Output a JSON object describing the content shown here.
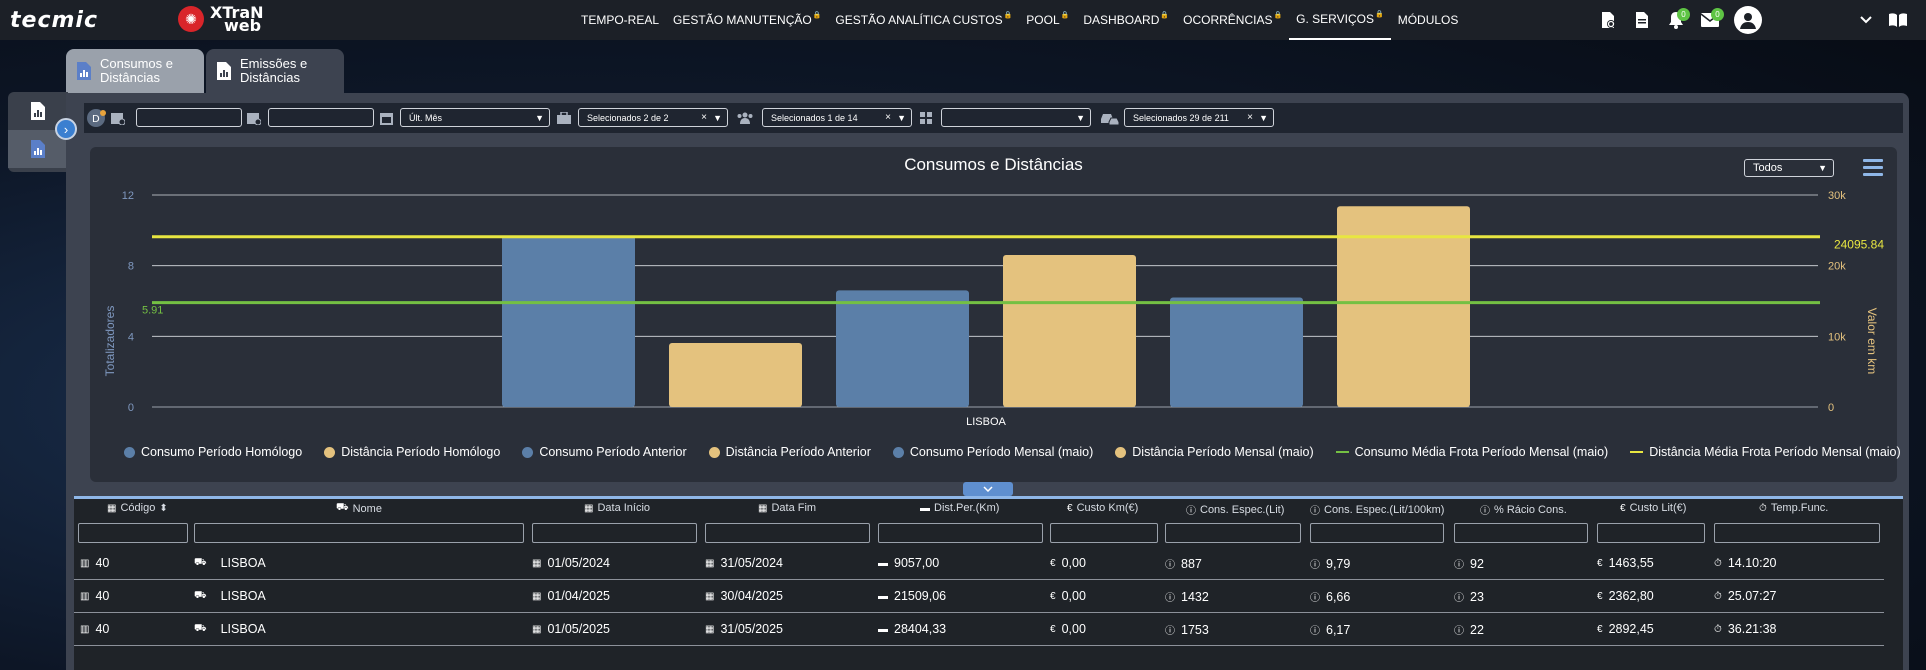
{
  "nav": {
    "logo_left": "tecmic",
    "logo_right_top": "XTraN",
    "logo_right_bottom": "web",
    "menu": [
      {
        "label": "TEMPO-REAL",
        "locked": false
      },
      {
        "label": "GESTÃO MANUTENÇÃO",
        "locked": true
      },
      {
        "label": "GESTÃO ANALÍTICA CUSTOS",
        "locked": true
      },
      {
        "label": "POOL",
        "locked": true
      },
      {
        "label": "DASHBOARD",
        "locked": true
      },
      {
        "label": "OCORRÊNCIAS",
        "locked": true
      },
      {
        "label": "G. SERVIÇOS",
        "locked": true,
        "active": true
      },
      {
        "label": "MÓDULOS",
        "locked": false
      }
    ],
    "notifications_count": "0",
    "messages_count": "0"
  },
  "tabs": [
    {
      "label_line1": "Consumos e",
      "label_line2": "Distâncias",
      "active": true
    },
    {
      "label_line1": "Emissões e",
      "label_line2": "Distâncias",
      "active": false
    }
  ],
  "filters": {
    "date_start": "",
    "date_end": "",
    "period": "Últ. Mês",
    "companies": "Selecionados 2 de 2",
    "groups": "Selecionados 1 de 14",
    "layout": "",
    "vehicles": "Selecionados 29 de 211"
  },
  "chart_selector": "Todos",
  "chart_data": {
    "type": "bar",
    "title": "Consumos e Distâncias",
    "categories": [
      "LISBOA"
    ],
    "ylabel_left": "Totalizadores",
    "ylabel_right": "Valor em km",
    "ylim_left": [
      0,
      12
    ],
    "yticks_left": [
      "0",
      "4",
      "8",
      "12"
    ],
    "ylim_right": [
      0,
      30000
    ],
    "yticks_right": [
      "0",
      "10k",
      "20k",
      "30k"
    ],
    "series": [
      {
        "name": "Consumo Período Homólogo",
        "axis": "left",
        "value": 9.7,
        "color": "#5b7fa8"
      },
      {
        "name": "Distância Período Homólogo",
        "axis": "right",
        "value": 9057,
        "color": "#e4c27e"
      },
      {
        "name": "Consumo Período Anterior",
        "axis": "left",
        "value": 6.6,
        "color": "#5b7fa8"
      },
      {
        "name": "Distância Período Anterior",
        "axis": "right",
        "value": 21509,
        "color": "#e4c27e"
      },
      {
        "name": "Consumo Período Mensal (maio)",
        "axis": "left",
        "value": 6.2,
        "color": "#5b7fa8"
      },
      {
        "name": "Distância Período Mensal (maio)",
        "axis": "right",
        "value": 28404,
        "color": "#e4c27e"
      }
    ],
    "lines": [
      {
        "name": "Consumo Média Frota Período Mensal (maio)",
        "axis": "left",
        "value": 5.91,
        "label": "5.91",
        "color": "#74c043"
      },
      {
        "name": "Distância Média Frota Período Mensal (maio)",
        "axis": "right",
        "value": 24095.84,
        "label": "24095.84",
        "color": "#e8e641"
      }
    ],
    "grid": true,
    "legend": "bottom"
  },
  "table": {
    "headers": [
      "Código",
      "Nome",
      "Data Início",
      "Data Fim",
      "Dist.Per.(Km)",
      "Custo Km(€)",
      "Cons. Espec.(Lit)",
      "Cons. Espec.(Lit/100km)",
      "% Rácio Cons.",
      "Custo Lit(€)",
      "Temp.Func."
    ],
    "rows": [
      [
        "40",
        "LISBOA",
        "01/05/2024",
        "31/05/2024",
        "9057,00",
        "0,00",
        "887",
        "9,79",
        "92",
        "1463,55",
        "14.10:20"
      ],
      [
        "40",
        "LISBOA",
        "01/04/2025",
        "30/04/2025",
        "21509,06",
        "0,00",
        "1432",
        "6,66",
        "23",
        "2362,80",
        "25.07:27"
      ],
      [
        "40",
        "LISBOA",
        "01/05/2025",
        "31/05/2025",
        "28404,33",
        "0,00",
        "1753",
        "6,17",
        "22",
        "2892,45",
        "36.21:38"
      ]
    ]
  }
}
